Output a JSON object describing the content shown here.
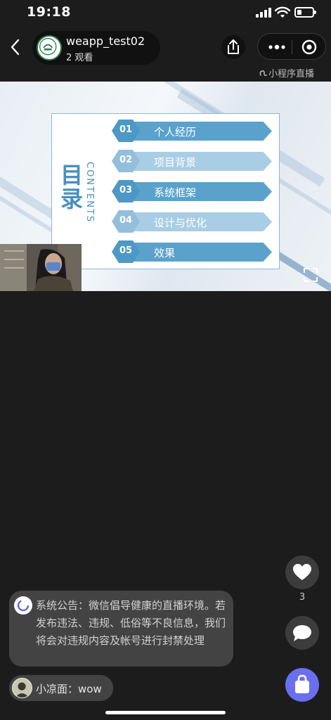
{
  "status_bar": {
    "time": "19:18",
    "battery_level": 0.3
  },
  "header": {
    "host_name": "weapp_test02",
    "viewer_count": "2 观看",
    "mini_program_label": "小程序直播"
  },
  "slide": {
    "title": "目录",
    "contents_label": "CONTENTS",
    "items": [
      {
        "num": "01",
        "label": "个人经历"
      },
      {
        "num": "02",
        "label": "项目背景"
      },
      {
        "num": "03",
        "label": "系统框架"
      },
      {
        "num": "04",
        "label": "设计与优化"
      },
      {
        "num": "05",
        "label": "效果"
      }
    ],
    "colors": {
      "dark": "#5aa2cc",
      "light": "#a9cde4",
      "title": "#4a8fc0"
    }
  },
  "actions": {
    "like_count": "3",
    "shop_color": "#6a6ff0"
  },
  "notice": {
    "text": "系统公告：微信倡导健康的直播环境。若发布违法、违规、低俗等不良信息，我们将会对违规内容及帐号进行封禁处理"
  },
  "comment": {
    "text": "小凉面：wow"
  },
  "icons": [
    "back-icon",
    "share-icon",
    "more-icon",
    "close-icon",
    "heart-icon",
    "comment-icon",
    "shopping-bag-icon",
    "fullscreen-icon"
  ]
}
